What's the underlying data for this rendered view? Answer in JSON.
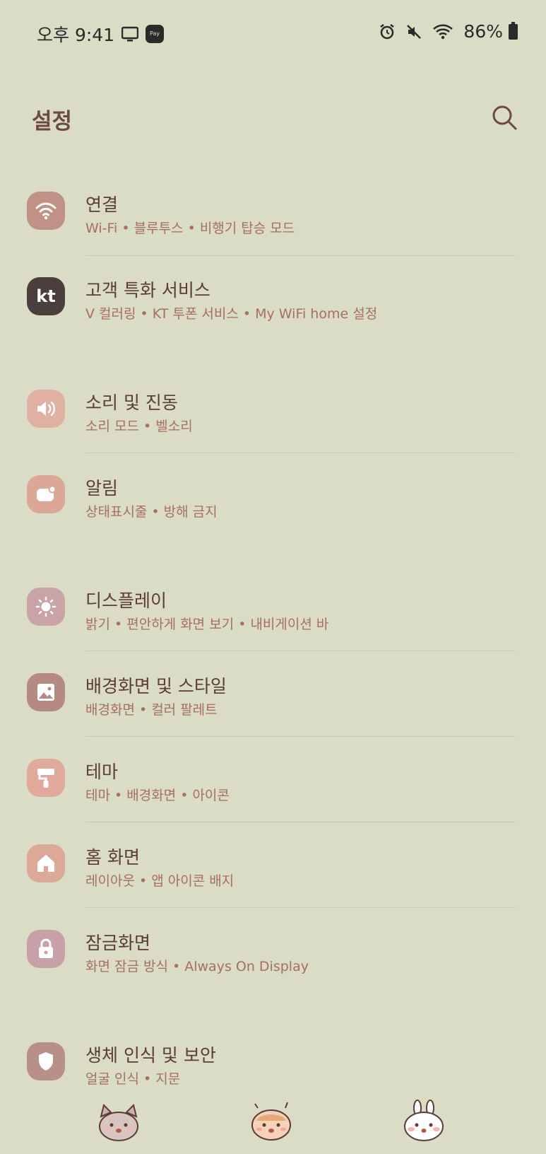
{
  "status_bar": {
    "time": "오후 9:41",
    "pay_label": "Pay",
    "battery": "86%"
  },
  "header": {
    "title": "설정",
    "search_icon": "search-icon"
  },
  "items": [
    {
      "label": "연결",
      "sub": "Wi-Fi  •  블루투스  •  비행기 탑승 모드",
      "icon": "wifi-icon",
      "color": "#c19186"
    },
    {
      "label": "고객 특화 서비스",
      "sub": "V 컬러링  •  KT 투폰 서비스  •  My WiFi home 설정",
      "icon": "kt-logo-icon",
      "icon_text": "kt",
      "color": "#4a3f3d"
    },
    {
      "label": "소리 및 진동",
      "sub": "소리 모드  •  벨소리",
      "icon": "speaker-icon",
      "color": "#e0b0a2"
    },
    {
      "label": "알림",
      "sub": "상태표시줄  •  방해 금지",
      "icon": "notification-icon",
      "color": "#dba897"
    },
    {
      "label": "디스플레이",
      "sub": "밝기  •  편안하게 화면 보기  •  내비게이션 바",
      "icon": "sun-icon",
      "color": "#c9a3a6"
    },
    {
      "label": "배경화면 및 스타일",
      "sub": "배경화면  •  컬러 팔레트",
      "icon": "image-icon",
      "color": "#b48a82"
    },
    {
      "label": "테마",
      "sub": "테마  •  배경화면  •  아이콘",
      "icon": "paint-roller-icon",
      "color": "#e0a99c"
    },
    {
      "label": "홈 화면",
      "sub": "레이아웃  •  앱 아이콘 배지",
      "icon": "home-icon",
      "color": "#dca898"
    },
    {
      "label": "잠금화면",
      "sub": "화면 잠금 방식  •  Always On Display",
      "icon": "lock-icon",
      "color": "#c8a0a8"
    },
    {
      "label": "생체 인식 및 보안",
      "sub": "얼굴 인식  •  지문",
      "icon": "shield-icon",
      "color": "#b89088"
    }
  ],
  "stickers": [
    "cat-sticker-icon",
    "hamster-sticker-icon",
    "bunny-sticker-icon"
  ]
}
